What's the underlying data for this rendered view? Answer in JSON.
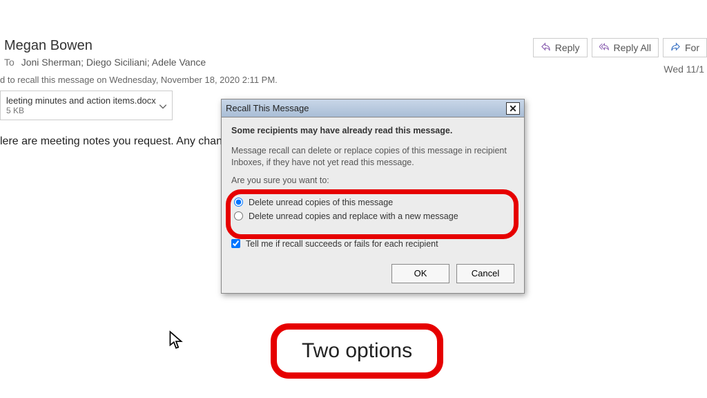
{
  "message": {
    "sender": "Megan Bowen",
    "to_label": "To",
    "recipients": "Joni Sherman; Diego Siciliani; Adele Vance",
    "recall_note": "d to recall this message on Wednesday, November 18, 2020 2:11 PM.",
    "attachment": {
      "name": "leeting minutes and action items.docx",
      "size": "5 KB"
    },
    "body": "lere are meeting notes you request. Any changes,"
  },
  "actions": {
    "reply": "Reply",
    "reply_all": "Reply All",
    "forward": "For"
  },
  "date": "Wed 11/1",
  "dialog": {
    "title": "Recall This Message",
    "heading": "Some recipients may have already read this message.",
    "info": "Message recall can delete or replace copies of this message in recipient Inboxes, if they have not yet read this message.",
    "prompt": "Are you sure you want to:",
    "option1": "Delete unread copies of this message",
    "option2": "Delete unread copies and replace with a new message",
    "tell_me": "Tell me if recall succeeds or fails for each recipient",
    "ok": "OK",
    "cancel": "Cancel"
  },
  "annotation": {
    "two_options": "Two options"
  }
}
